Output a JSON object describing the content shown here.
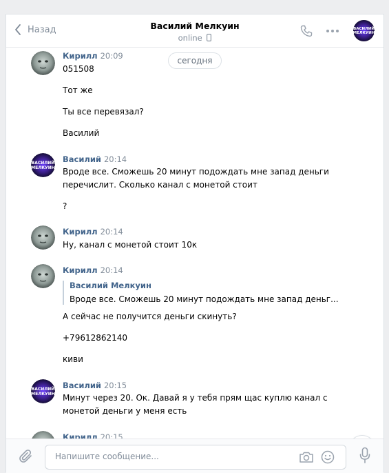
{
  "header": {
    "back_label": "Назад",
    "title": "Василий Мелкуин",
    "status": "online"
  },
  "date_divider": "сегодня",
  "messages": [
    {
      "author": "Кирилл",
      "time": "20:09",
      "lines": [
        "051508",
        "Тот же",
        "Ты все перевязал?",
        "Василий"
      ]
    },
    {
      "author": "Василий",
      "time": "20:14",
      "lines": [
        "Вроде все. Сможешь 20 минут подождать мне запад деньги",
        "перечислит. Сколько канал с монетой стоит",
        "?"
      ]
    },
    {
      "author": "Кирилл",
      "time": "20:14",
      "lines": [
        "Ну, канал с монетой стоит 10к"
      ]
    },
    {
      "author": "Кирилл",
      "time": "20:14",
      "reply": {
        "author": "Василий Мелкуин",
        "text": "Вроде все. Сможешь 20 минут подождать мне запад деньг..."
      },
      "lines": [
        "А сейчас не получится деньги скинуть?",
        "+79612862140",
        "киви"
      ]
    },
    {
      "author": "Василий",
      "time": "20:15",
      "lines": [
        "Минут через 20. Ок. Давай я у тебя прям щас куплю канал с",
        "монетой деньги у меня есть"
      ]
    },
    {
      "author": "Кирилл",
      "time": "20:15",
      "lines": []
    }
  ],
  "composer": {
    "placeholder": "Напишите сообщение..."
  },
  "icons": {
    "back": "chevron-left-icon",
    "phone": "phone-icon",
    "more": "more-dots-icon",
    "attach": "paperclip-icon",
    "camera": "camera-icon",
    "emoji": "smile-icon",
    "mic": "microphone-icon",
    "scroll": "chevron-down-icon"
  },
  "colors": {
    "accent": "#42648b",
    "muted": "#818c99",
    "avatar_purple": "#3b1f8a"
  }
}
